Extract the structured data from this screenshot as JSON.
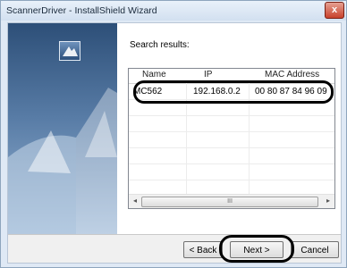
{
  "window": {
    "title": "ScannerDriver - InstallShield Wizard",
    "close_glyph": "x"
  },
  "icons": {
    "logo": "installshield-logo-icon",
    "close": "close-icon"
  },
  "content": {
    "heading": "Search results:"
  },
  "table": {
    "columns": [
      "Name",
      "IP",
      "MAC Address"
    ],
    "rows": [
      {
        "name": "MC562",
        "ip": "192.168.0.2",
        "mac": "00 80 87 84 96 09"
      }
    ]
  },
  "scrollbar": {
    "left_arrow": "◂",
    "right_arrow": "▸",
    "thumb_grip": "III"
  },
  "buttons": {
    "back": "< Back",
    "next": "Next >",
    "cancel": "Cancel"
  },
  "colors": {
    "side_panel": "#2d4f78",
    "highlight_ring": "#000000"
  }
}
